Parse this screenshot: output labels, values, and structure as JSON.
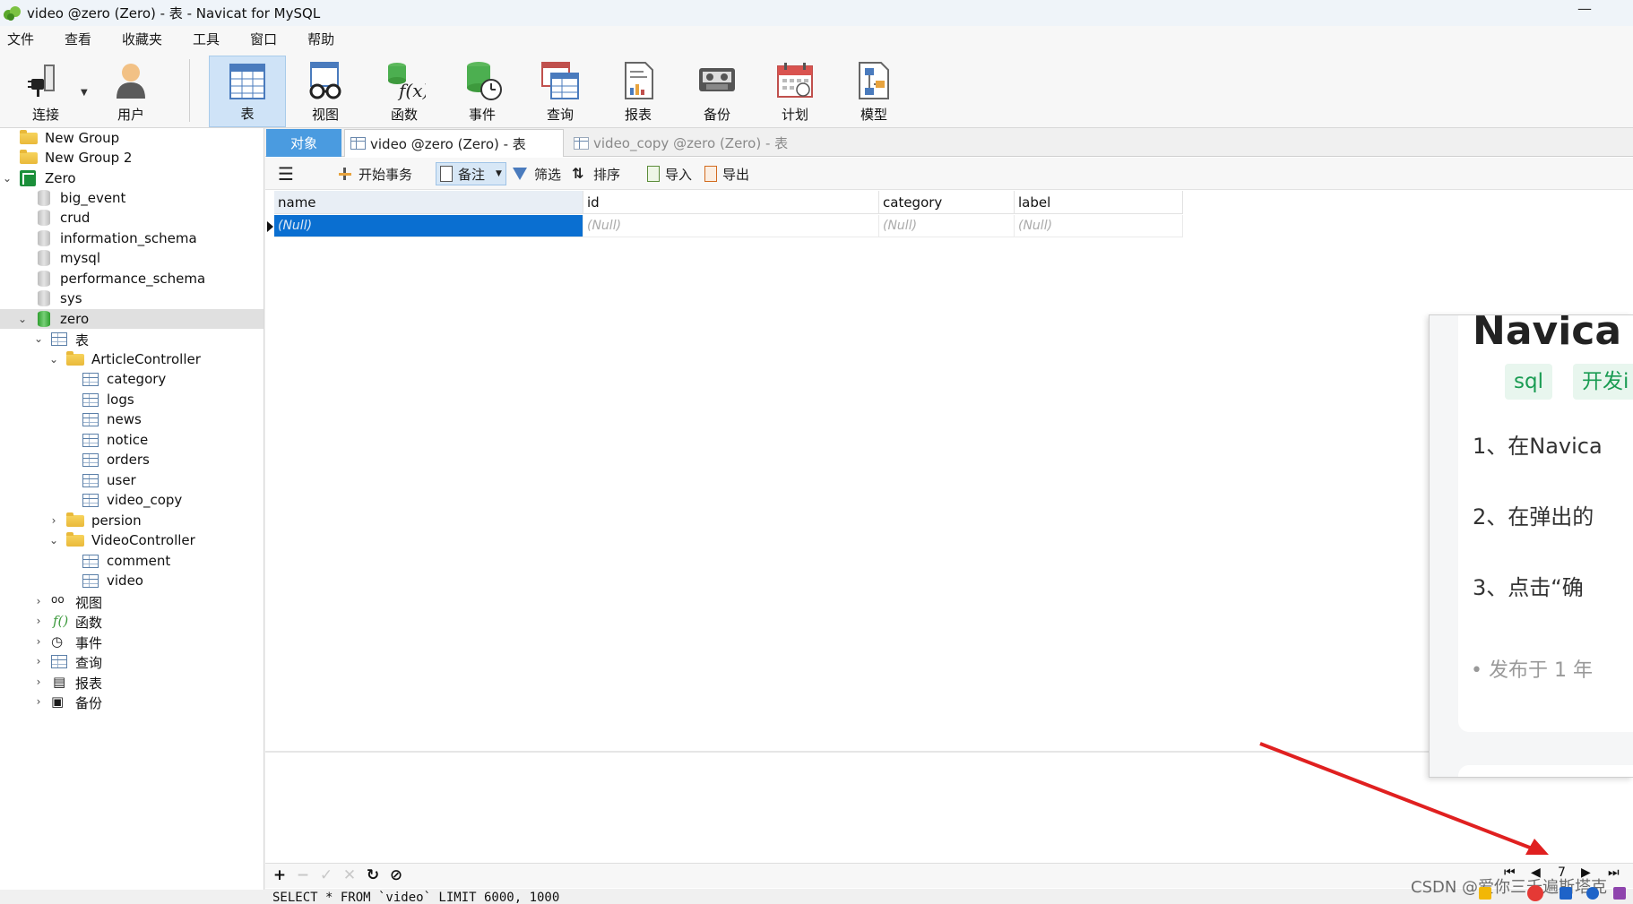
{
  "window": {
    "title": "video @zero (Zero) - 表 - Navicat for MySQL",
    "minimize_glyph": "—"
  },
  "menu": [
    "文件",
    "查看",
    "收藏夹",
    "工具",
    "窗口",
    "帮助"
  ],
  "toolbar": {
    "buttons": [
      {
        "label": "连接",
        "icon": "plug-icon"
      },
      {
        "label": "用户",
        "icon": "user-icon"
      },
      {
        "label": "表",
        "icon": "table-icon",
        "active": true
      },
      {
        "label": "视图",
        "icon": "view-glasses-icon"
      },
      {
        "label": "函数",
        "icon": "function-icon"
      },
      {
        "label": "事件",
        "icon": "event-clock-icon"
      },
      {
        "label": "查询",
        "icon": "query-icon"
      },
      {
        "label": "报表",
        "icon": "report-icon"
      },
      {
        "label": "备份",
        "icon": "backup-tape-icon"
      },
      {
        "label": "计划",
        "icon": "calendar-icon"
      },
      {
        "label": "模型",
        "icon": "model-icon"
      }
    ]
  },
  "tree": {
    "groups": [
      "New Group",
      "New Group 2"
    ],
    "connection": "Zero",
    "databases": [
      "big_event",
      "crud",
      "information_schema",
      "mysql",
      "performance_schema",
      "sys",
      "zero"
    ],
    "tables_node": "表",
    "article_group": "ArticleController",
    "article_tables": [
      "category",
      "logs",
      "news",
      "notice",
      "orders",
      "user",
      "video_copy"
    ],
    "persion_group": "persion",
    "video_group": "VideoController",
    "video_tables": [
      "comment",
      "video"
    ],
    "other_nodes": [
      "视图",
      "函数",
      "事件",
      "查询",
      "报表",
      "备份"
    ]
  },
  "tabs": {
    "objects": "对象",
    "active": "video @zero (Zero) - 表",
    "inactive": "video_copy @zero (Zero) - 表"
  },
  "subtoolbar": {
    "begin_transaction": "开始事务",
    "memo": "备注",
    "filter": "筛选",
    "sort": "排序",
    "import": "导入",
    "export": "导出"
  },
  "grid": {
    "columns": [
      "name",
      "id",
      "category",
      "label"
    ],
    "rows": [
      [
        "(Null)",
        "(Null)",
        "(Null)",
        "(Null)"
      ]
    ]
  },
  "status": {
    "sql": "SELECT * FROM `video` LIMIT 6000, 1000",
    "page": "7"
  },
  "overlay": {
    "title_fragment": "Navica",
    "tags": [
      "sql",
      "开发i"
    ],
    "steps": [
      "1、在Navica",
      "2、在弹出的",
      "3、点击“确"
    ],
    "published": "• 发布于 1 年"
  },
  "watermark": "CSDN @爱你三千遍斯塔克",
  "colors": {
    "selection_blue": "#0a6fd1",
    "objects_tab": "#4a9be0",
    "arrow_red": "#e02020",
    "tag_green": "#1a9c53"
  }
}
